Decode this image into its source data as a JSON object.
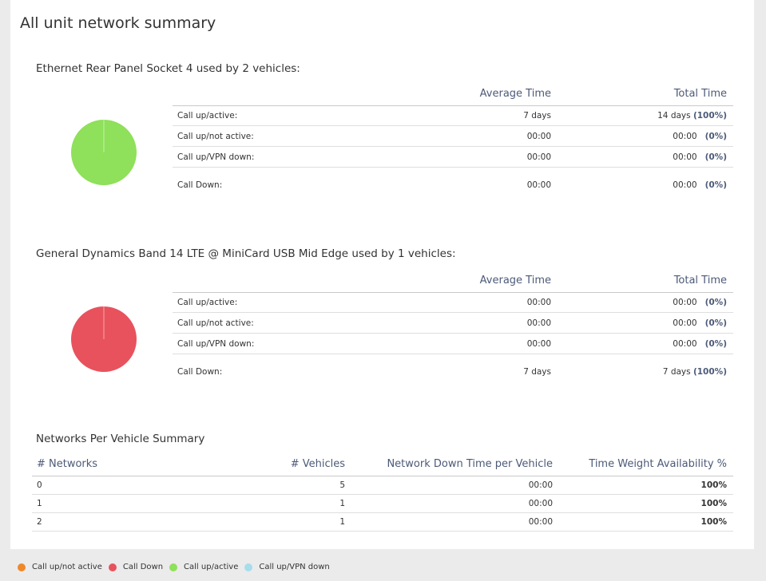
{
  "page": {
    "title": "All unit network summary"
  },
  "colors": {
    "call_up_not_active": "#f0882a",
    "call_down": "#e8525d",
    "call_up_active": "#8fe05a",
    "call_up_vpn_down": "#a7dceb",
    "header_text": "#4c5a78"
  },
  "networks": [
    {
      "title": "Ethernet Rear Panel Socket 4 used by 2 vehicles:",
      "pie_color": "#8fe05a",
      "pie_status": "Call up/active",
      "pie_fraction": 1.0,
      "headers": {
        "avg": "Average Time",
        "total": "Total Time"
      },
      "rows": [
        {
          "label": "Call up/active:",
          "avg": "7 days",
          "total": "14 days",
          "pct": "(100%)"
        },
        {
          "label": "Call up/not active:",
          "avg": "00:00",
          "total": "00:00",
          "pct": "(0%)"
        },
        {
          "label": "Call up/VPN down:",
          "avg": "00:00",
          "total": "00:00",
          "pct": "(0%)"
        },
        {
          "label": "Call Down:",
          "avg": "00:00",
          "total": "00:00",
          "pct": "(0%)"
        }
      ]
    },
    {
      "title": "General Dynamics Band 14 LTE @ MiniCard USB Mid Edge used by 1 vehicles:",
      "pie_color": "#e8525d",
      "pie_status": "Call Down",
      "pie_fraction": 1.0,
      "headers": {
        "avg": "Average Time",
        "total": "Total Time"
      },
      "rows": [
        {
          "label": "Call up/active:",
          "avg": "00:00",
          "total": "00:00",
          "pct": "(0%)"
        },
        {
          "label": "Call up/not active:",
          "avg": "00:00",
          "total": "00:00",
          "pct": "(0%)"
        },
        {
          "label": "Call up/VPN down:",
          "avg": "00:00",
          "total": "00:00",
          "pct": "(0%)"
        },
        {
          "label": "Call Down:",
          "avg": "7 days",
          "total": "7 days",
          "pct": "(100%)"
        }
      ]
    }
  ],
  "summary": {
    "title": "Networks Per Vehicle Summary",
    "headers": {
      "networks": "# Networks",
      "vehicles": "# Vehicles",
      "downtime": "Network Down Time per Vehicle",
      "availability": "Time Weight Availability %"
    },
    "rows": [
      {
        "networks": "0",
        "vehicles": "5",
        "downtime": "00:00",
        "availability": "100%"
      },
      {
        "networks": "1",
        "vehicles": "1",
        "downtime": "00:00",
        "availability": "100%"
      },
      {
        "networks": "2",
        "vehicles": "1",
        "downtime": "00:00",
        "availability": "100%"
      }
    ]
  },
  "legend": [
    {
      "label": "Call up/not active",
      "color": "#f0882a"
    },
    {
      "label": "Call Down",
      "color": "#e8525d"
    },
    {
      "label": "Call up/active",
      "color": "#8fe05a"
    },
    {
      "label": "Call up/VPN down",
      "color": "#a7dceb"
    }
  ]
}
